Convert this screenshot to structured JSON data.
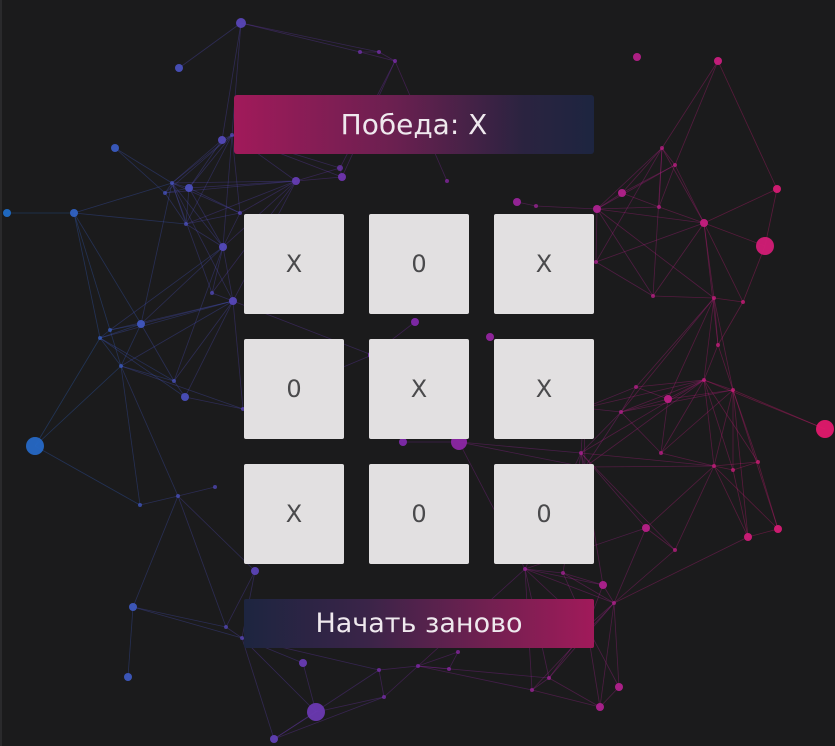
{
  "status": {
    "text": "Победа: X"
  },
  "board": {
    "cells": [
      "X",
      "0",
      "X",
      "0",
      "X",
      "X",
      "X",
      "0",
      "0"
    ]
  },
  "restart": {
    "label": "Начать заново"
  },
  "colors": {
    "background": "#1b1b1c",
    "accent_pink": "#e3196b",
    "accent_blue": "#1e6ec8",
    "cell_background": "#e2e0e1",
    "mark_color": "#4a4a4c"
  }
}
